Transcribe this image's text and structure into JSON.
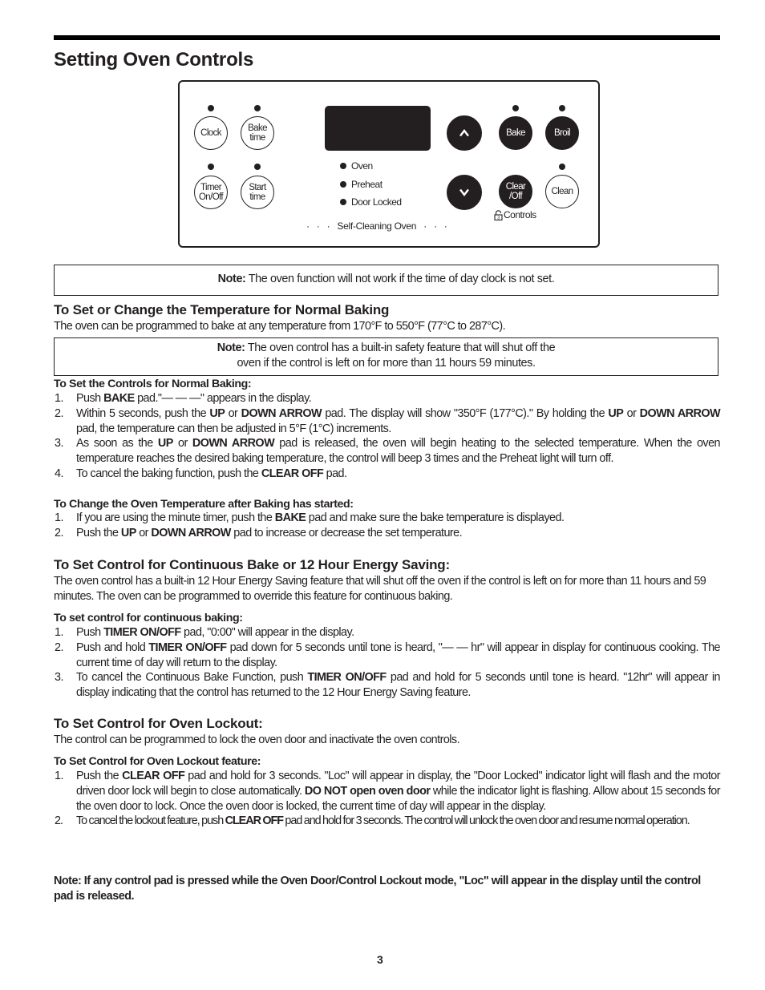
{
  "page": {
    "title": "Setting Oven Controls",
    "page_number": "3"
  },
  "panel": {
    "pads": {
      "clock": "Clock",
      "bake_time_1": "Bake",
      "bake_time_2": "time",
      "timer_1": "Timer",
      "timer_2": "On/Off",
      "start_time_1": "Start",
      "start_time_2": "time",
      "up_arrow": "^",
      "down_arrow": "v",
      "bake": "Bake",
      "broil": "Broil",
      "clear_1": "Clear",
      "clear_2": "/Off",
      "clean": "Clean"
    },
    "indicators": [
      "Oven",
      "Preheat",
      "Door Locked"
    ],
    "controls_lock_label": "Controls",
    "self_cleaning_label": "Self-Cleaning Oven",
    "dots_left": "·   ·   ·",
    "dots_right": "·   ·   ·"
  },
  "note1": {
    "label": "Note:",
    "text": " The oven function will not work if the time of day clock is not set."
  },
  "section1": {
    "heading": "To Set or Change the Temperature for Normal Baking",
    "intro": "The oven can be programmed to bake at any temperature from 170°F to 550°F (77°C to 287°C).",
    "note": {
      "label": "Note:",
      "line1": " The oven control has a built-in safety feature that will shut off the",
      "line2": "oven if the control is left on for more than 11 hours 59 minutes."
    },
    "sub1": {
      "heading": "To Set the Controls for Normal Baking:",
      "steps": [
        {
          "num": "1.",
          "parts": [
            {
              "t": "Push "
            },
            {
              "b": "BAKE"
            },
            {
              "t": " pad.\"— — —\" appears in the display."
            }
          ]
        },
        {
          "num": "2.",
          "parts": [
            {
              "t": "Within 5 seconds, push the "
            },
            {
              "b": "UP"
            },
            {
              "t": " or "
            },
            {
              "b": "DOWN ARROW"
            },
            {
              "t": " pad.  The display will show \"350°F (177°C).\" By holding the "
            },
            {
              "b": "UP"
            },
            {
              "t": " or "
            },
            {
              "b": "DOWN ARROW"
            },
            {
              "t": " pad, the temperature can then be adjusted in 5°F (1°C) increments."
            }
          ]
        },
        {
          "num": "3.",
          "parts": [
            {
              "t": "As soon as the "
            },
            {
              "b": "UP"
            },
            {
              "t": " or "
            },
            {
              "b": "DOWN ARROW"
            },
            {
              "t": " pad is released, the oven will begin heating to the selected temperature. When the oven temperature reaches the desired baking temperature, the control will beep 3 times and the Preheat light will turn off."
            }
          ]
        },
        {
          "num": "4.",
          "parts": [
            {
              "t": "To cancel the baking function, push the "
            },
            {
              "b": "CLEAR OFF"
            },
            {
              "t": " pad."
            }
          ]
        }
      ]
    },
    "sub2": {
      "heading": "To Change the Oven Temperature after Baking has started:",
      "steps": [
        {
          "num": "1.",
          "parts": [
            {
              "t": "If you are using the minute timer, push the "
            },
            {
              "b": "BAKE"
            },
            {
              "t": " pad and make sure the bake temperature is displayed."
            }
          ]
        },
        {
          "num": "2.",
          "parts": [
            {
              "t": "Push the "
            },
            {
              "b": "UP"
            },
            {
              "t": " or "
            },
            {
              "b": "DOWN ARROW"
            },
            {
              "t": " pad to increase or decrease the set temperature."
            }
          ]
        }
      ]
    }
  },
  "section2": {
    "heading": "To Set Control for Continuous Bake or 12 Hour Energy Saving:",
    "intro": "The oven control has a built-in 12 Hour Energy Saving feature that will shut off the oven if the control is left on for more than 11 hours and 59 minutes. The oven can be programmed to override this feature for continuous baking.",
    "sub": {
      "heading": "To set control for continuous baking:",
      "steps": [
        {
          "num": "1.",
          "parts": [
            {
              "t": "Push "
            },
            {
              "b": "TIMER ON/OFF"
            },
            {
              "t": " pad, \"0:00\" will appear in the display."
            }
          ]
        },
        {
          "num": "2.",
          "parts": [
            {
              "t": "Push and hold "
            },
            {
              "b": "TIMER ON/OFF"
            },
            {
              "t": " pad down for 5 seconds until tone is heard, \"— — hr\" will appear in display for continuous cooking. The current time of day will return to the display."
            }
          ]
        },
        {
          "num": "3.",
          "parts": [
            {
              "t": "To cancel the Continuous Bake Function, push "
            },
            {
              "b": "TIMER ON/OFF"
            },
            {
              "t": " pad and hold for 5 seconds until tone is heard. \"12hr\" will appear in display indicating that the control has returned to the 12 Hour Energy Saving feature."
            }
          ]
        }
      ]
    }
  },
  "section3": {
    "heading": "To Set Control for Oven Lockout:",
    "intro": "The control can be programmed to lock the oven door and inactivate the oven controls.",
    "sub": {
      "heading": "To Set Control for Oven Lockout feature:",
      "steps": [
        {
          "num": "1.",
          "parts": [
            {
              "t": "Push the "
            },
            {
              "b": "CLEAR OFF"
            },
            {
              "t": " pad and hold for 3 seconds. \"Loc\" will appear in display, the \"Door Locked\" indicator light will flash and the motor driven door lock will begin to close automatically. "
            },
            {
              "b": "DO NOT open oven door"
            },
            {
              "t": " while the indicator light is flashing. Allow about 15 seconds for the oven door to lock. Once the oven door is locked, the current time of day will appear in the display."
            }
          ]
        },
        {
          "num": "2.",
          "parts": [
            {
              "t": "To cancel the lockout feature, push "
            },
            {
              "b": "CLEAR OFF"
            },
            {
              "t": " pad and hold for 3 seconds. The control will unlock the oven door and resume normal operation."
            }
          ]
        }
      ]
    }
  },
  "final_note": "Note: If any control pad is pressed while the Oven Door/Control Lockout mode, \"Loc\" will appear in the display until the control pad is released."
}
